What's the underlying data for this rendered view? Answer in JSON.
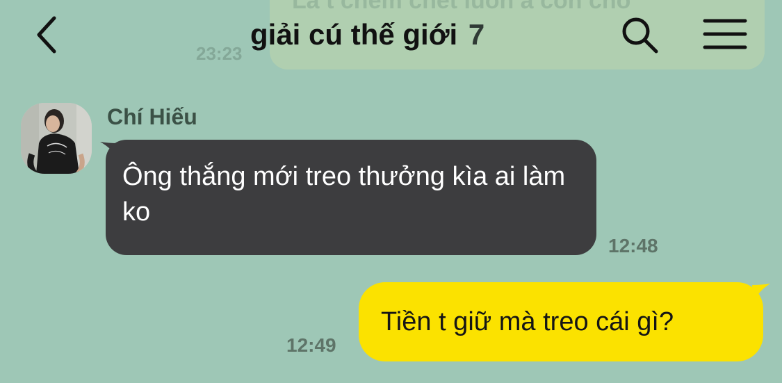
{
  "background": {
    "chat_bg_color": "#9ec7b6",
    "previous_message_text": "Là t chém chết luôn á còn cho",
    "previous_message_time": "23:23"
  },
  "header": {
    "title": "giải cú thế giới",
    "member_count": "7",
    "back_icon": "chevron-left-icon",
    "search_icon": "search-icon",
    "menu_icon": "hamburger-menu-icon"
  },
  "messages": {
    "incoming": {
      "sender": "Chí Hiếu",
      "text": "Ông thắng mới treo thưởng kìa ai làm ko",
      "time": "12:48",
      "bubble_color": "#3d3d3f"
    },
    "outgoing": {
      "text": "Tiền t giữ mà treo cái gì?",
      "time": "12:49",
      "bubble_color": "#fbe200"
    }
  }
}
